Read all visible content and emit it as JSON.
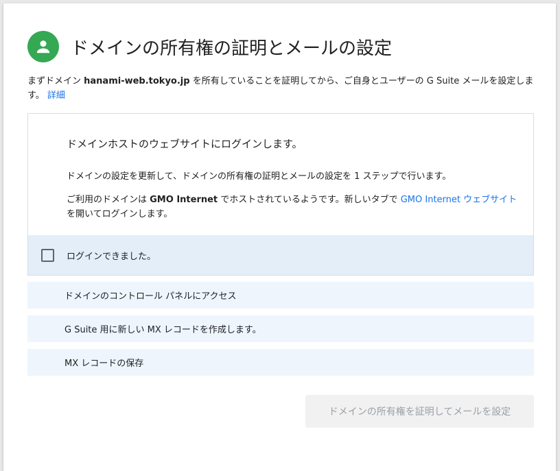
{
  "dialog": {
    "title": "ドメインの所有権の証明とメールの設定",
    "avatar_icon": "person-icon",
    "avatar_color": "#34a853",
    "intro": {
      "prefix": "まずドメイン ",
      "domain": "hanami-web.tokyo.jp",
      "suffix": " を所有していることを証明してから、ご自身とユーザーの G Suite メールを設定します。 ",
      "details_link": "詳細"
    },
    "active_step": {
      "heading": "ドメインホストのウェブサイトにログインします。",
      "description": "ドメインの設定を更新して、ドメインの所有権の証明とメールの設定を 1 ステップで行います。",
      "host_prefix": "ご利用のドメインは ",
      "host_name": "GMO Internet",
      "host_middle": " でホストされているようです。新しいタブで ",
      "host_link": "GMO Internet ウェブサイト",
      "host_suffix": "を開いてログインします。",
      "checkbox_label": "ログインできました。",
      "checkbox_checked": false
    },
    "steps": [
      {
        "label": "ドメインのコントロール パネルにアクセス"
      },
      {
        "label": "G Suite 用に新しい MX レコードを作成します。"
      },
      {
        "label": "MX レコードの保存"
      }
    ],
    "submit_label": "ドメインの所有権を証明してメールを設定",
    "submit_disabled": true
  }
}
